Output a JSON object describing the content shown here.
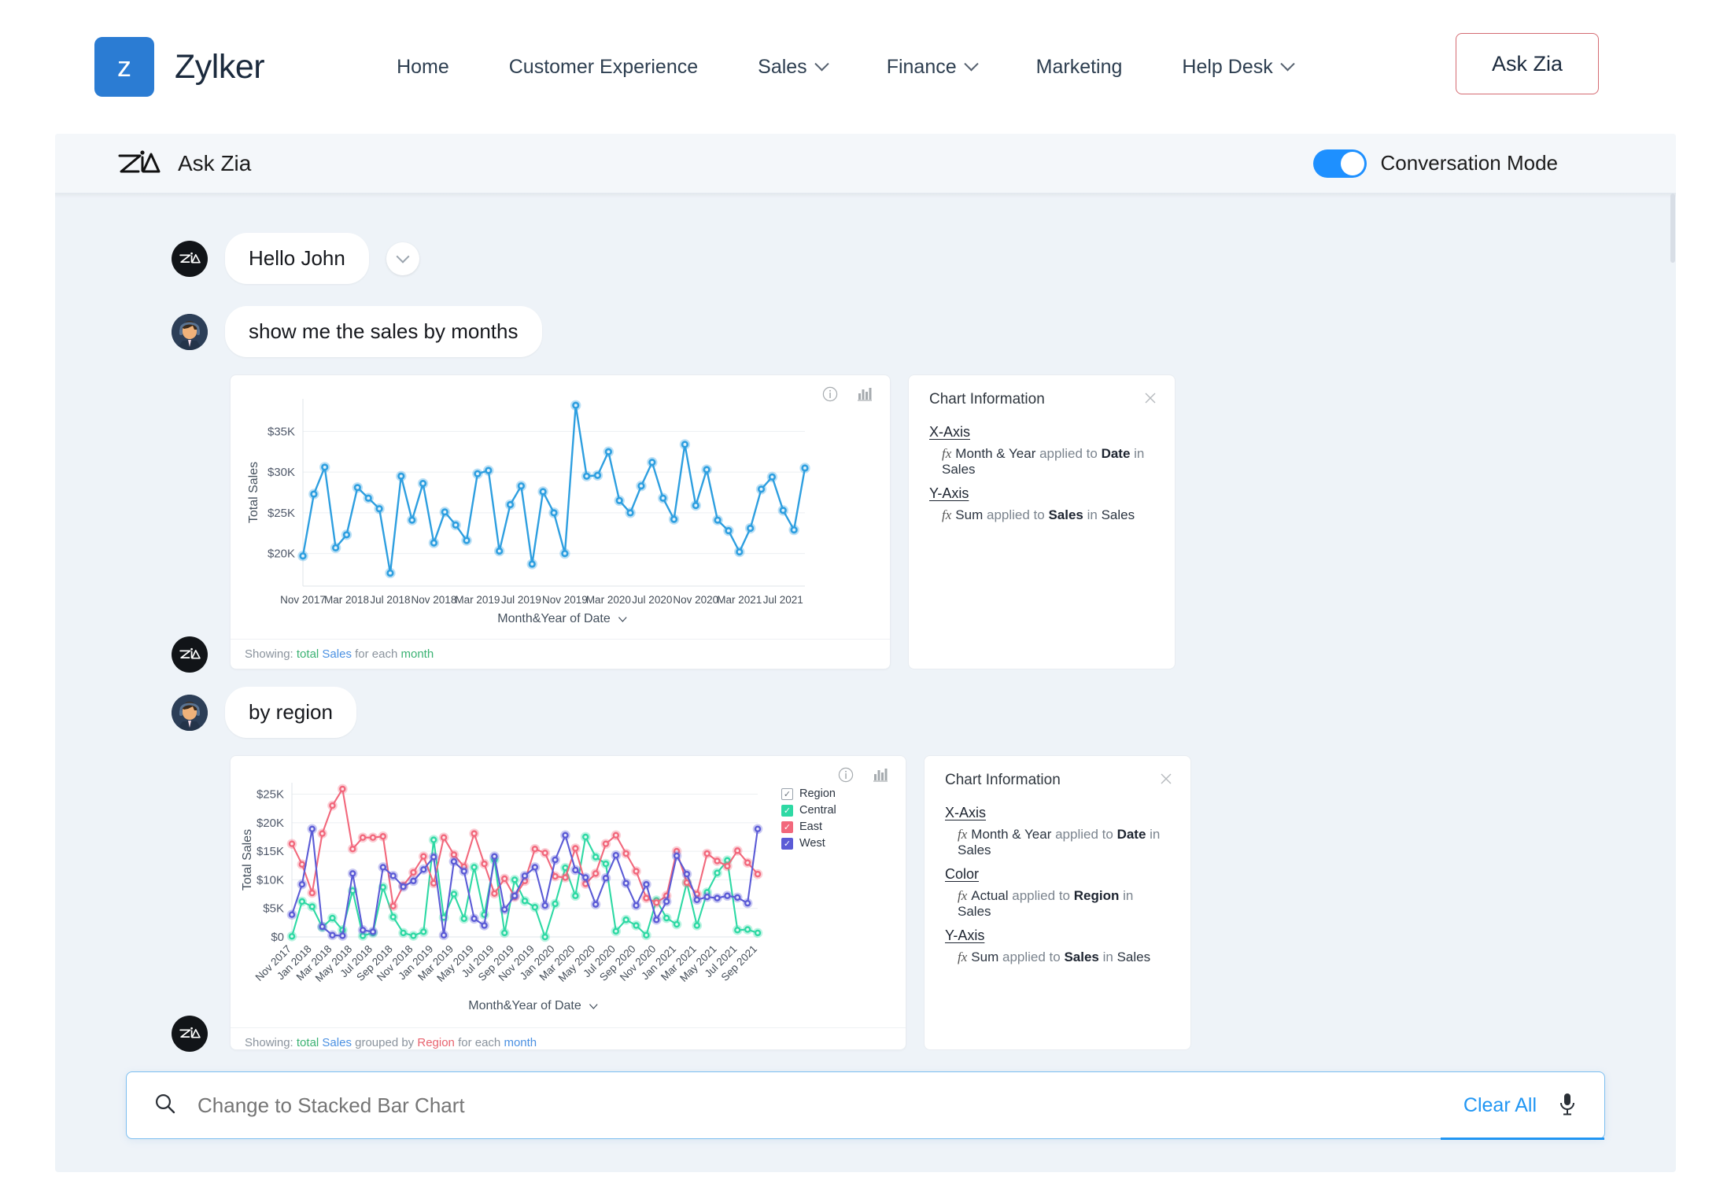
{
  "topnav": {
    "logo_letter": "z",
    "brand": "Zylker",
    "links": [
      {
        "label": "Home",
        "has_caret": false
      },
      {
        "label": "Customer Experience",
        "has_caret": false
      },
      {
        "label": "Sales",
        "has_caret": true
      },
      {
        "label": "Finance",
        "has_caret": true
      },
      {
        "label": "Marketing",
        "has_caret": false
      },
      {
        "label": "Help Desk",
        "has_caret": true
      }
    ],
    "ask_zia_button": "Ask Zia"
  },
  "zia_header": {
    "title": "Ask Zia",
    "logo_icon": "zia-logo-icon",
    "toggle_label": "Conversation Mode",
    "toggle_on": true,
    "toggle_color": "#1e90ff"
  },
  "chat": {
    "messages": [
      {
        "from": "zia",
        "text": "Hello John",
        "has_chevron": true
      },
      {
        "from": "user",
        "text": "show me the sales by months"
      },
      {
        "from": "user",
        "text": "by region"
      }
    ]
  },
  "chart1": {
    "icons": [
      "info-icon",
      "chart-type-icon"
    ],
    "footer": {
      "prefix": "Showing:",
      "total": "total",
      "measure": "Sales",
      "mid": "for each",
      "group": "month"
    },
    "info": {
      "title": "Chart Information",
      "close_icon": "close-icon",
      "sections": [
        {
          "name": "X-Axis",
          "fx": "fx",
          "expr": "Month & Year",
          "applied": "applied to",
          "field": "Date",
          "in": "in",
          "source": "Sales"
        },
        {
          "name": "Y-Axis",
          "fx": "fx",
          "expr": "Sum",
          "applied": "applied to",
          "field": "Sales",
          "in": "in",
          "source": "Sales"
        }
      ]
    }
  },
  "chart2": {
    "icons": [
      "info-icon",
      "chart-type-icon"
    ],
    "legend_title": "Region",
    "footer": {
      "prefix": "Showing:",
      "total": "total",
      "measure": "Sales",
      "mid": "grouped by",
      "groupby": "Region",
      "mid2": "for each",
      "group": "month"
    },
    "info": {
      "title": "Chart Information",
      "close_icon": "close-icon",
      "sections": [
        {
          "name": "X-Axis",
          "fx": "fx",
          "expr": "Month & Year",
          "applied": "applied to",
          "field": "Date",
          "in": "in",
          "source": "Sales"
        },
        {
          "name": "Color",
          "fx": "fx",
          "expr": "Actual",
          "applied": "applied to",
          "field": "Region",
          "in": "in",
          "source": "Sales"
        },
        {
          "name": "Y-Axis",
          "fx": "fx",
          "expr": "Sum",
          "applied": "applied to",
          "field": "Sales",
          "in": "in",
          "source": "Sales"
        }
      ]
    }
  },
  "search": {
    "icon": "search-icon",
    "placeholder": "Change to Stacked Bar Chart",
    "value": "",
    "clear_all": "Clear All",
    "mic_icon": "microphone-icon"
  },
  "chart_data": [
    {
      "type": "line",
      "title": "",
      "xlabel": "Month&Year of Date",
      "ylabel": "Total Sales",
      "ylim": [
        16000,
        39000
      ],
      "yticks": [
        20000,
        25000,
        30000,
        35000
      ],
      "ytick_labels": [
        "$20K",
        "$25K",
        "$30K",
        "$35K"
      ],
      "grid": true,
      "legend": "none",
      "color": "#2e9fe0",
      "x": [
        "Nov 2017",
        "Dec 2017",
        "Jan 2018",
        "Feb 2018",
        "Mar 2018",
        "Apr 2018",
        "May 2018",
        "Jun 2018",
        "Jul 2018",
        "Aug 2018",
        "Sep 2018",
        "Oct 2018",
        "Nov 2018",
        "Dec 2018",
        "Jan 2019",
        "Feb 2019",
        "Mar 2019",
        "Apr 2019",
        "May 2019",
        "Jun 2019",
        "Jul 2019",
        "Aug 2019",
        "Sep 2019",
        "Oct 2019",
        "Nov 2019",
        "Dec 2019",
        "Jan 2020",
        "Feb 2020",
        "Mar 2020",
        "Apr 2020",
        "May 2020",
        "Jun 2020",
        "Jul 2020",
        "Aug 2020",
        "Sep 2020",
        "Oct 2020",
        "Nov 2020",
        "Dec 2020",
        "Jan 2021",
        "Feb 2021",
        "Mar 2021",
        "Apr 2021",
        "May 2021",
        "Jun 2021",
        "Jul 2021",
        "Aug 2021",
        "Sep 2021"
      ],
      "xtick_labels": [
        "Nov 2017",
        "Mar 2018",
        "Jul 2018",
        "Nov 2018",
        "Mar 2019",
        "Jul 2019",
        "Nov 2019",
        "Mar 2020",
        "Jul 2020",
        "Nov 2020",
        "Mar 2021",
        "Jul 2021"
      ],
      "values": [
        19700,
        27300,
        30600,
        20700,
        22300,
        28100,
        26800,
        25500,
        17600,
        29500,
        24100,
        28600,
        21300,
        25100,
        23500,
        21600,
        29800,
        30200,
        20300,
        26000,
        28300,
        18700,
        27600,
        25000,
        20000,
        38200,
        29500,
        29600,
        32500,
        26500,
        25000,
        28300,
        31200,
        26800,
        24200,
        33400,
        25900,
        30300,
        24100,
        22800,
        20200,
        23100,
        27900,
        29400,
        25300,
        22900,
        30500
      ]
    },
    {
      "type": "line",
      "title": "",
      "xlabel": "Month&Year of Date",
      "ylabel": "Total Sales",
      "ylim": [
        0,
        27000
      ],
      "yticks": [
        0,
        5000,
        10000,
        15000,
        20000,
        25000
      ],
      "ytick_labels": [
        "$0",
        "$5K",
        "$10K",
        "$15K",
        "$20K",
        "$25K"
      ],
      "grid": true,
      "legend": "right",
      "legend_title": "Region",
      "x": [
        "Nov 2017",
        "Dec 2017",
        "Jan 2018",
        "Feb 2018",
        "Mar 2018",
        "Apr 2018",
        "May 2018",
        "Jun 2018",
        "Jul 2018",
        "Aug 2018",
        "Sep 2018",
        "Oct 2018",
        "Nov 2018",
        "Dec 2018",
        "Jan 2019",
        "Feb 2019",
        "Mar 2019",
        "Apr 2019",
        "May 2019",
        "Jun 2019",
        "Jul 2019",
        "Aug 2019",
        "Sep 2019",
        "Oct 2019",
        "Nov 2019",
        "Dec 2019",
        "Jan 2020",
        "Feb 2020",
        "Mar 2020",
        "Apr 2020",
        "May 2020",
        "Jun 2020",
        "Jul 2020",
        "Aug 2020",
        "Sep 2020",
        "Oct 2020",
        "Nov 2020",
        "Dec 2020",
        "Jan 2021",
        "Feb 2021",
        "Mar 2021",
        "Apr 2021",
        "May 2021",
        "Jun 2021",
        "Jul 2021",
        "Aug 2021",
        "Sep 2021"
      ],
      "xtick_labels": [
        "Nov 2017",
        "Jan 2018",
        "Mar 2018",
        "May 2018",
        "Jul 2018",
        "Sep 2018",
        "Nov 2018",
        "Jan 2019",
        "Mar 2019",
        "May 2019",
        "Jul 2019",
        "Sep 2019",
        "Nov 2019",
        "Jan 2020",
        "Mar 2020",
        "May 2020",
        "Jul 2020",
        "Sep 2020",
        "Nov 2020",
        "Jan 2021",
        "Mar 2021",
        "May 2021",
        "Jul 2021",
        "Sep 2021"
      ],
      "series": [
        {
          "name": "Central",
          "color": "#2ed9a4",
          "values": [
            100,
            6200,
            5300,
            1700,
            3300,
            1200,
            8100,
            200,
            700,
            8700,
            3500,
            700,
            200,
            900,
            17000,
            3400,
            7500,
            3200,
            12200,
            3900,
            13500,
            700,
            10000,
            6300,
            5200,
            0,
            5800,
            12100,
            7200,
            17500,
            14000,
            12800,
            1000,
            3000,
            2000,
            300,
            6400,
            3300,
            2200,
            9500,
            2000,
            7800,
            11200,
            13400,
            1200,
            1300,
            700
          ]
        },
        {
          "name": "East",
          "color": "#f2687c",
          "values": [
            16300,
            12700,
            7700,
            18100,
            23000,
            25900,
            15400,
            17400,
            17400,
            17600,
            5400,
            9000,
            11300,
            14100,
            9400,
            17400,
            14400,
            12300,
            18100,
            12800,
            7600,
            10200,
            7000,
            9800,
            15400,
            14700,
            10600,
            10400,
            15500,
            9300,
            11100,
            16300,
            17800,
            14600,
            11500,
            6800,
            6000,
            7200,
            15000,
            9500,
            7500,
            14600,
            13300,
            12400,
            15100,
            13000,
            11000
          ]
        },
        {
          "name": "West",
          "color": "#5b5bd6",
          "values": [
            3900,
            9200,
            18900,
            1800,
            300,
            200,
            11100,
            1200,
            900,
            12200,
            10700,
            8800,
            9800,
            11800,
            14000,
            300,
            13200,
            11500,
            3200,
            2000,
            14100,
            4800,
            7200,
            10700,
            12200,
            5500,
            13500,
            17800,
            11700,
            10400,
            5700,
            10300,
            14300,
            9400,
            5500,
            9200,
            3000,
            6200,
            14200,
            11000,
            6500,
            7000,
            6800,
            7200,
            6900,
            5900,
            18900
          ]
        }
      ]
    }
  ]
}
